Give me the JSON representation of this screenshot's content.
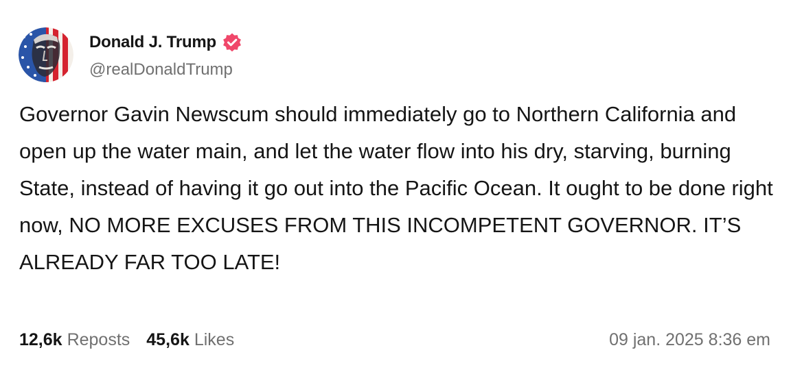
{
  "author": {
    "display_name": "Donald J. Trump",
    "handle": "@realDonaldTrump",
    "verified": true,
    "badge_color": "#f0476a"
  },
  "post": {
    "text": "Governor Gavin Newscum should immediately go to Northern California and open up the water main, and let the water flow into his dry, starving, burning State, instead of having it go out into the Pacific Ocean. It ought to be done right now, NO MORE EXCUSES FROM THIS INCOMPETENT GOVERNOR. IT’S ALREADY FAR TOO LATE!"
  },
  "stats": {
    "reposts_count": "12,6k",
    "reposts_label": "Reposts",
    "likes_count": "45,6k",
    "likes_label": "Likes"
  },
  "timestamp": "09 jan. 2025 8:36 em",
  "colors": {
    "text": "#151515",
    "muted": "#707070",
    "background": "#ffffff"
  }
}
